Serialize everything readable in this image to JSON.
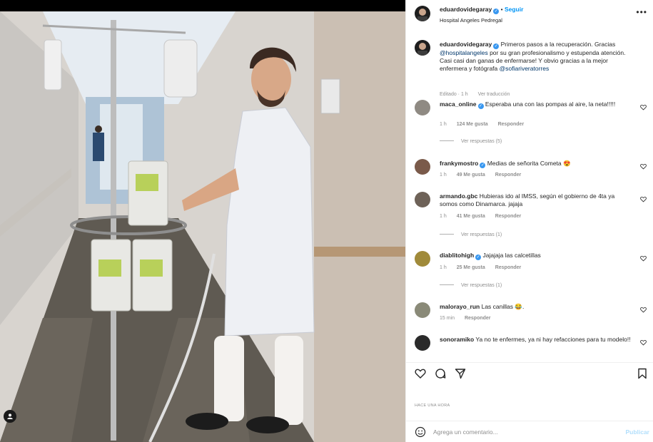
{
  "post": {
    "username": "eduardovidegaray",
    "follow_label": "Seguir",
    "location": "Hospital Angeles Pedregal",
    "more_icon": "more-horizontal-icon",
    "caption": {
      "username": "eduardovidegaray",
      "text_a": "Primeros pasos a la recuperación. Gracias",
      "mention_a": "@hospitalangeles",
      "text_b": "por su gran profesionalismo y estupenda atención. Casi casi dan ganas de enfermarse! Y obvio gracias a la mejor enfermera y fotógrafa",
      "mention_b": "@sofiariveratorres",
      "edited": "Editado · 1 h",
      "translate": "Ver traducción"
    },
    "time_ago": "HACE UNA HORA"
  },
  "comments": [
    {
      "username": "maca_online",
      "verified": true,
      "text": "Esperaba una con las pompas al aire, la neta!!!!!",
      "time": "1 h",
      "likes": "124 Me gusta",
      "reply": "Responder",
      "replies": "Ver respuestas (5)"
    },
    {
      "username": "frankymostro",
      "verified": true,
      "text": "Medias de señorita Cometa 😍",
      "time": "1 h",
      "likes": "49 Me gusta",
      "reply": "Responder",
      "replies": ""
    },
    {
      "username": "armando.gbc",
      "verified": false,
      "text": "Hubieras ido al IMSS, según el gobierno de 4ta ya somos como Dinamarca. jajaja",
      "time": "1 h",
      "likes": "41 Me gusta",
      "reply": "Responder",
      "replies": "Ver respuestas (1)"
    },
    {
      "username": "diablitohigh",
      "verified": true,
      "text": "Jajajaja las calcetillas",
      "time": "1 h",
      "likes": "25 Me gusta",
      "reply": "Responder",
      "replies": "Ver respuestas (1)"
    },
    {
      "username": "malorayo_run",
      "verified": false,
      "text": "Las canillas 😂.",
      "time": "15 min",
      "likes": "",
      "reply": "Responder",
      "replies": ""
    },
    {
      "username": "sonoramiko",
      "verified": false,
      "text": "Ya no te enfermes, ya ni hay refacciones para tu modelo!!",
      "time": "",
      "likes": "",
      "reply": "",
      "replies": ""
    }
  ],
  "actions": {
    "like_icon": "heart-icon",
    "comment_icon": "comment-icon",
    "share_icon": "share-icon",
    "save_icon": "bookmark-icon"
  },
  "add_comment": {
    "placeholder": "Agrega un comentario...",
    "post_label": "Publicar",
    "emoji_icon": "emoji-icon"
  },
  "colors": {
    "link": "#0095f6",
    "mention": "#00376b",
    "verified": "#3897f0",
    "muted": "#8e8e8e"
  }
}
